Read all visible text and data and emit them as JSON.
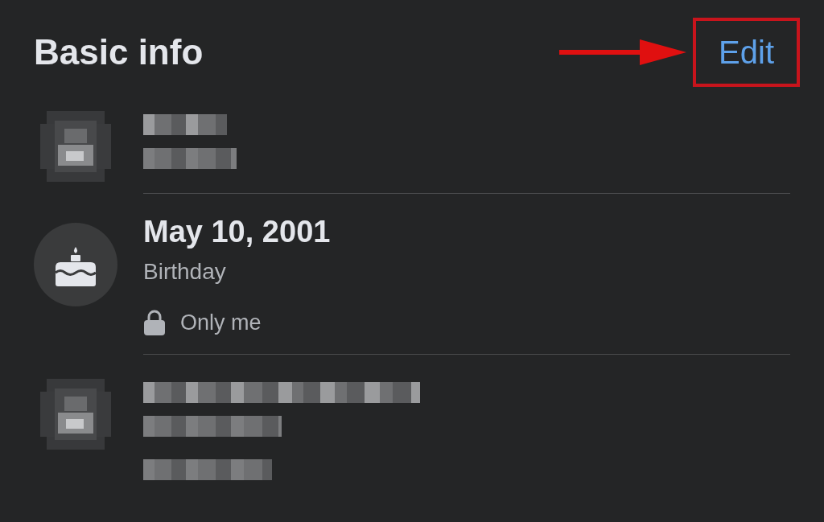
{
  "header": {
    "title": "Basic info",
    "edit": {
      "label": "Edit",
      "highlighted": true
    }
  },
  "items": [
    {
      "kind": "redacted_short"
    },
    {
      "kind": "info",
      "value": "May 10, 2001",
      "label": "Birthday",
      "privacy": "Only me"
    },
    {
      "kind": "redacted_long"
    }
  ]
}
